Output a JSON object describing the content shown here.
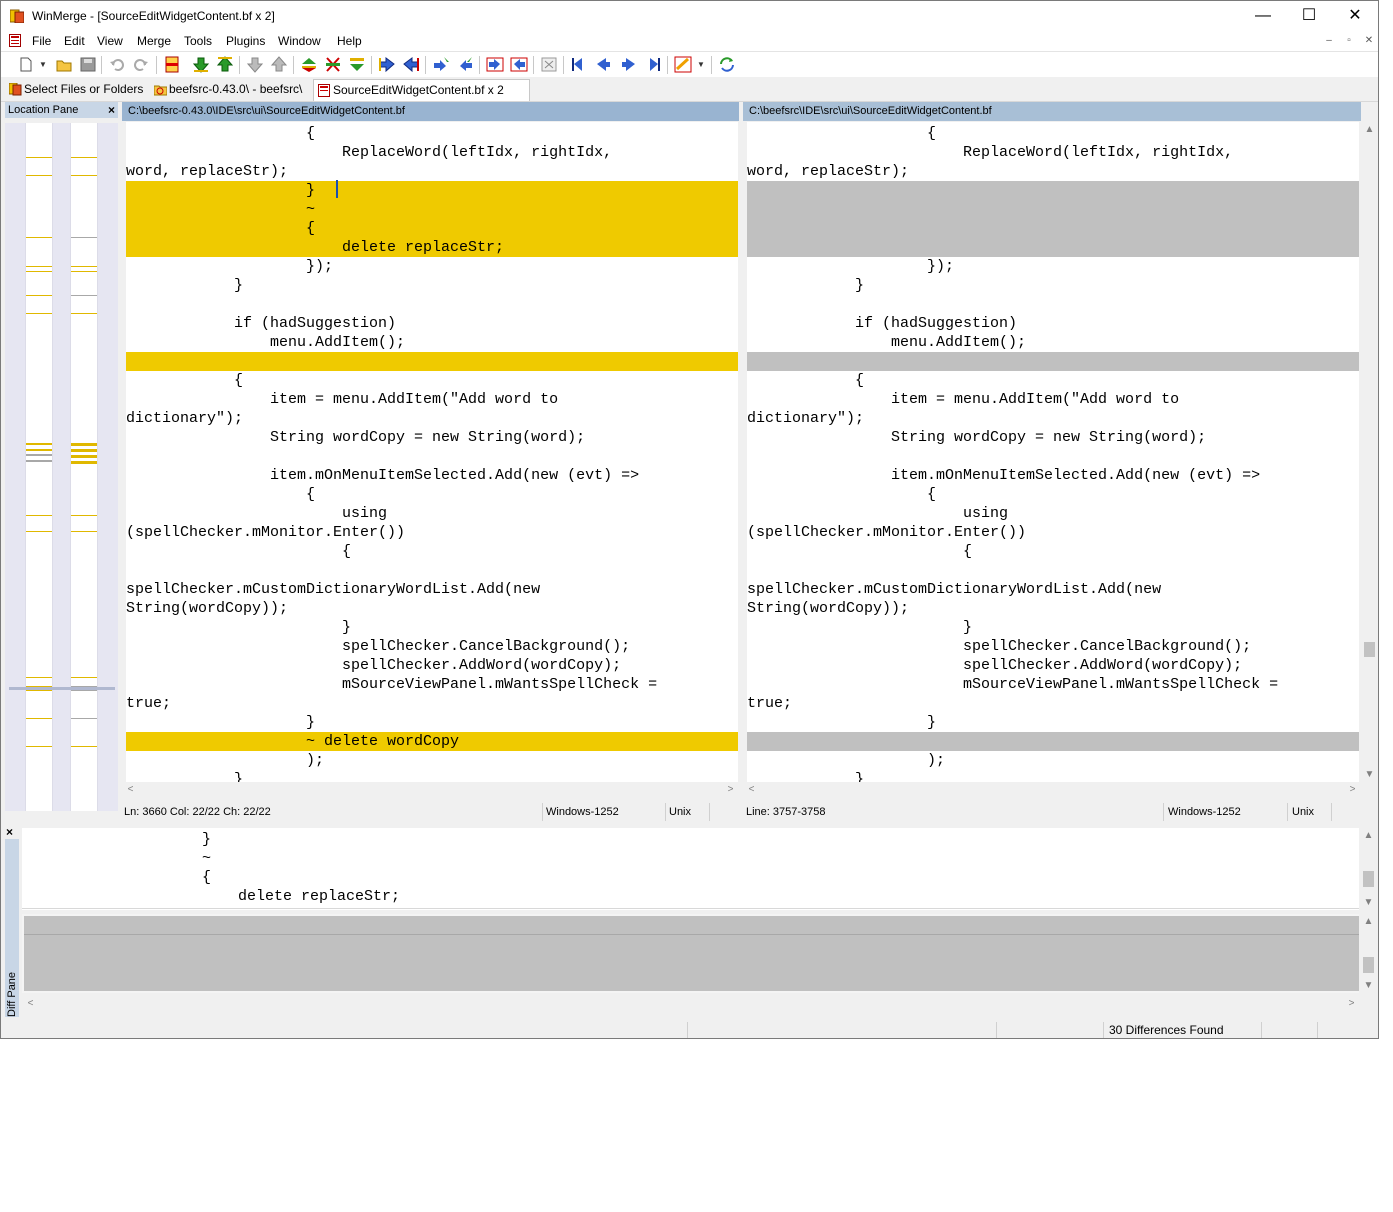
{
  "window": {
    "title": "WinMerge - [SourceEditWidgetContent.bf x 2]",
    "minimize": "—",
    "maximize": "☐",
    "close": "✕"
  },
  "menu": [
    "File",
    "Edit",
    "View",
    "Merge",
    "Tools",
    "Plugins",
    "Window",
    "Help"
  ],
  "mdi_controls": [
    "–",
    "▫",
    "✕"
  ],
  "toolbar_icons": [
    "new-icon",
    "open-icon",
    "save-icon",
    "undo-icon",
    "redo-icon",
    "copy-all-icon",
    "copy-down-icon",
    "copy-up-icon",
    "copy-down-disabled-icon",
    "copy-up-disabled-icon",
    "select-all-diff-icon",
    "next-diff-icon",
    "prev-diff-icon",
    "copy-right-icon",
    "copy-left-icon",
    "copy-right-advance-icon",
    "copy-left-advance-icon",
    "copy-to-right-icon",
    "copy-to-left-icon",
    "options-icon",
    "first-diff-icon",
    "prev-diff-nav-icon",
    "next-diff-nav-icon",
    "last-diff-icon",
    "compare-icon",
    "dropdown-icon",
    "refresh-icon"
  ],
  "tabs": [
    {
      "label": "Select Files or Folders",
      "icon": "winmerge-icon"
    },
    {
      "label": "beefsrc-0.43.0\\ - beefsrc\\",
      "icon": "folder-compare-icon"
    },
    {
      "label": "SourceEditWidgetContent.bf x 2",
      "icon": "file-compare-icon"
    }
  ],
  "location_pane": {
    "title": "Location Pane",
    "close": "×"
  },
  "left_pane": {
    "path": "C:\\beefsrc-0.43.0\\IDE\\src\\ui\\SourceEditWidgetContent.bf",
    "lines": [
      {
        "text": "                    {",
        "type": "normal"
      },
      {
        "text": "                        ReplaceWord(leftIdx, rightIdx,",
        "type": "normal"
      },
      {
        "text": "word, replaceStr);",
        "type": "normal"
      },
      {
        "text": "                    }",
        "type": "diff"
      },
      {
        "text": "                    ~",
        "type": "diff"
      },
      {
        "text": "                    {",
        "type": "diff"
      },
      {
        "text": "                        delete replaceStr;",
        "type": "diff"
      },
      {
        "text": "                    });",
        "type": "normal"
      },
      {
        "text": "            }",
        "type": "normal"
      },
      {
        "text": "",
        "type": "normal"
      },
      {
        "text": "            if (hadSuggestion)",
        "type": "normal"
      },
      {
        "text": "                menu.AddItem();",
        "type": "normal"
      },
      {
        "text": "",
        "type": "diff"
      },
      {
        "text": "            {",
        "type": "normal"
      },
      {
        "text": "                item = menu.AddItem(\"Add word to",
        "type": "normal"
      },
      {
        "text": "dictionary\");",
        "type": "normal"
      },
      {
        "text": "                String wordCopy = new String(word);",
        "type": "normal"
      },
      {
        "text": "",
        "type": "normal"
      },
      {
        "text": "                item.mOnMenuItemSelected.Add(new (evt) =>",
        "type": "normal"
      },
      {
        "text": "                    {",
        "type": "normal"
      },
      {
        "text": "                        using",
        "type": "normal"
      },
      {
        "text": "(spellChecker.mMonitor.Enter())",
        "type": "normal"
      },
      {
        "text": "                        {",
        "type": "normal"
      },
      {
        "text": "",
        "type": "normal"
      },
      {
        "text": "spellChecker.mCustomDictionaryWordList.Add(new",
        "type": "normal"
      },
      {
        "text": "String(wordCopy));",
        "type": "normal"
      },
      {
        "text": "                        }",
        "type": "normal"
      },
      {
        "text": "                        spellChecker.CancelBackground();",
        "type": "normal"
      },
      {
        "text": "                        spellChecker.AddWord(wordCopy);",
        "type": "normal"
      },
      {
        "text": "                        mSourceViewPanel.mWantsSpellCheck =",
        "type": "normal"
      },
      {
        "text": "true;",
        "type": "normal"
      },
      {
        "text": "                    }",
        "type": "normal"
      },
      {
        "text": "                    ~ delete wordCopy",
        "type": "diff"
      },
      {
        "text": "                    );",
        "type": "normal"
      },
      {
        "text": "            }",
        "type": "normal"
      }
    ],
    "status": {
      "position": "Ln: 3660  Col: 22/22  Ch: 22/22",
      "encoding": "Windows-1252",
      "eol": "Unix"
    }
  },
  "right_pane": {
    "path": "C:\\beefsrc\\IDE\\src\\ui\\SourceEditWidgetContent.bf",
    "lines": [
      {
        "text": "                    {",
        "type": "normal"
      },
      {
        "text": "                        ReplaceWord(leftIdx, rightIdx,",
        "type": "normal"
      },
      {
        "text": "word, replaceStr);",
        "type": "normal"
      },
      {
        "text": "",
        "type": "gone"
      },
      {
        "text": "",
        "type": "gone"
      },
      {
        "text": "",
        "type": "gone"
      },
      {
        "text": "",
        "type": "gone"
      },
      {
        "text": "                    });",
        "type": "normal"
      },
      {
        "text": "            }",
        "type": "normal"
      },
      {
        "text": "",
        "type": "normal"
      },
      {
        "text": "            if (hadSuggestion)",
        "type": "normal"
      },
      {
        "text": "                menu.AddItem();",
        "type": "normal"
      },
      {
        "text": "",
        "type": "gone"
      },
      {
        "text": "            {",
        "type": "normal"
      },
      {
        "text": "                item = menu.AddItem(\"Add word to",
        "type": "normal"
      },
      {
        "text": "dictionary\");",
        "type": "normal"
      },
      {
        "text": "                String wordCopy = new String(word);",
        "type": "normal"
      },
      {
        "text": "",
        "type": "normal"
      },
      {
        "text": "                item.mOnMenuItemSelected.Add(new (evt) =>",
        "type": "normal"
      },
      {
        "text": "                    {",
        "type": "normal"
      },
      {
        "text": "                        using",
        "type": "normal"
      },
      {
        "text": "(spellChecker.mMonitor.Enter())",
        "type": "normal"
      },
      {
        "text": "                        {",
        "type": "normal"
      },
      {
        "text": "",
        "type": "normal"
      },
      {
        "text": "spellChecker.mCustomDictionaryWordList.Add(new",
        "type": "normal"
      },
      {
        "text": "String(wordCopy));",
        "type": "normal"
      },
      {
        "text": "                        }",
        "type": "normal"
      },
      {
        "text": "                        spellChecker.CancelBackground();",
        "type": "normal"
      },
      {
        "text": "                        spellChecker.AddWord(wordCopy);",
        "type": "normal"
      },
      {
        "text": "                        mSourceViewPanel.mWantsSpellCheck =",
        "type": "normal"
      },
      {
        "text": "true;",
        "type": "normal"
      },
      {
        "text": "                    }",
        "type": "normal"
      },
      {
        "text": "",
        "type": "gone"
      },
      {
        "text": "                    );",
        "type": "normal"
      },
      {
        "text": "            }",
        "type": "normal"
      }
    ],
    "status": {
      "position": "Line: 3757-3758",
      "encoding": "Windows-1252",
      "eol": "Unix"
    }
  },
  "diff_pane": {
    "title": "Diff Pane",
    "close": "×",
    "top_lines": [
      "                    }",
      "                    ~",
      "                    {",
      "                        delete replaceStr;"
    ]
  },
  "status_bar": {
    "differences": "30 Differences Found"
  },
  "colors": {
    "diff": "#efca00",
    "missing": "#c0c0c0",
    "header": "#a8bfd6"
  }
}
